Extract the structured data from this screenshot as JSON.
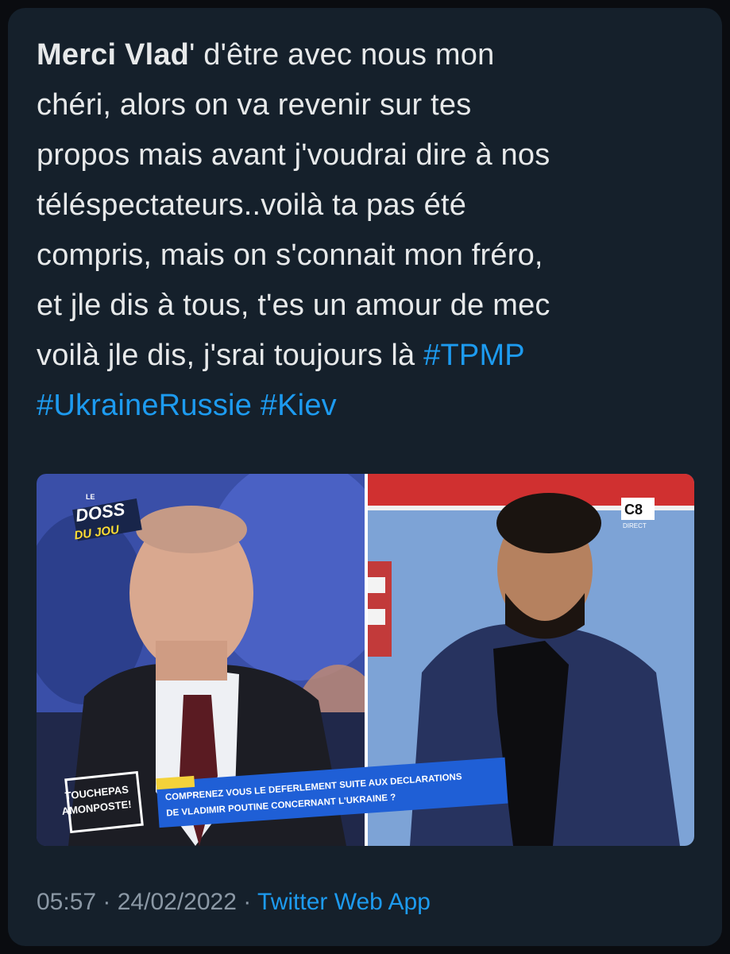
{
  "tweet": {
    "author_mention": "Merci Vlad",
    "text_line_1_rest": "' d'être avec nous mon",
    "text_line_2": "chéri, alors on va revenir sur tes",
    "text_line_3": "propos mais avant j'voudrai dire à nos",
    "text_line_4": "téléspectateurs..voilà ta pas été",
    "text_line_5": "compris, mais on s'connait mon fréro,",
    "text_line_6": "et jle dis à tous, t'es un amour de mec",
    "text_line_7": "voilà jle dis, j'srai toujours là ",
    "hashtags": [
      "#TPMP",
      "#UkraineRussie",
      "#Kiev"
    ]
  },
  "media": {
    "overlay_logo_top": "LE",
    "overlay_logo_line1": "DOSS",
    "overlay_logo_line2": "DU JOU",
    "channel_logo": "C8",
    "channel_sub": "DIRECT",
    "show_logo_line1": "TOUCHEPAS",
    "show_logo_line2": "AMONPOSTE!",
    "banner_line1": "COMPRENEZ VOUS LE DEFERLEMENT SUITE AUX DECLARATIONS",
    "banner_line2": "DE VLADIMIR POUTINE CONCERNANT L'UKRAINE ?"
  },
  "meta": {
    "time": "05:57",
    "separator": " · ",
    "date": "24/02/2022",
    "source": "Twitter Web App"
  },
  "colors": {
    "card_bg": "#15202b",
    "text": "#e7e9ea",
    "link": "#1d9bf0",
    "muted": "#8b98a5"
  }
}
